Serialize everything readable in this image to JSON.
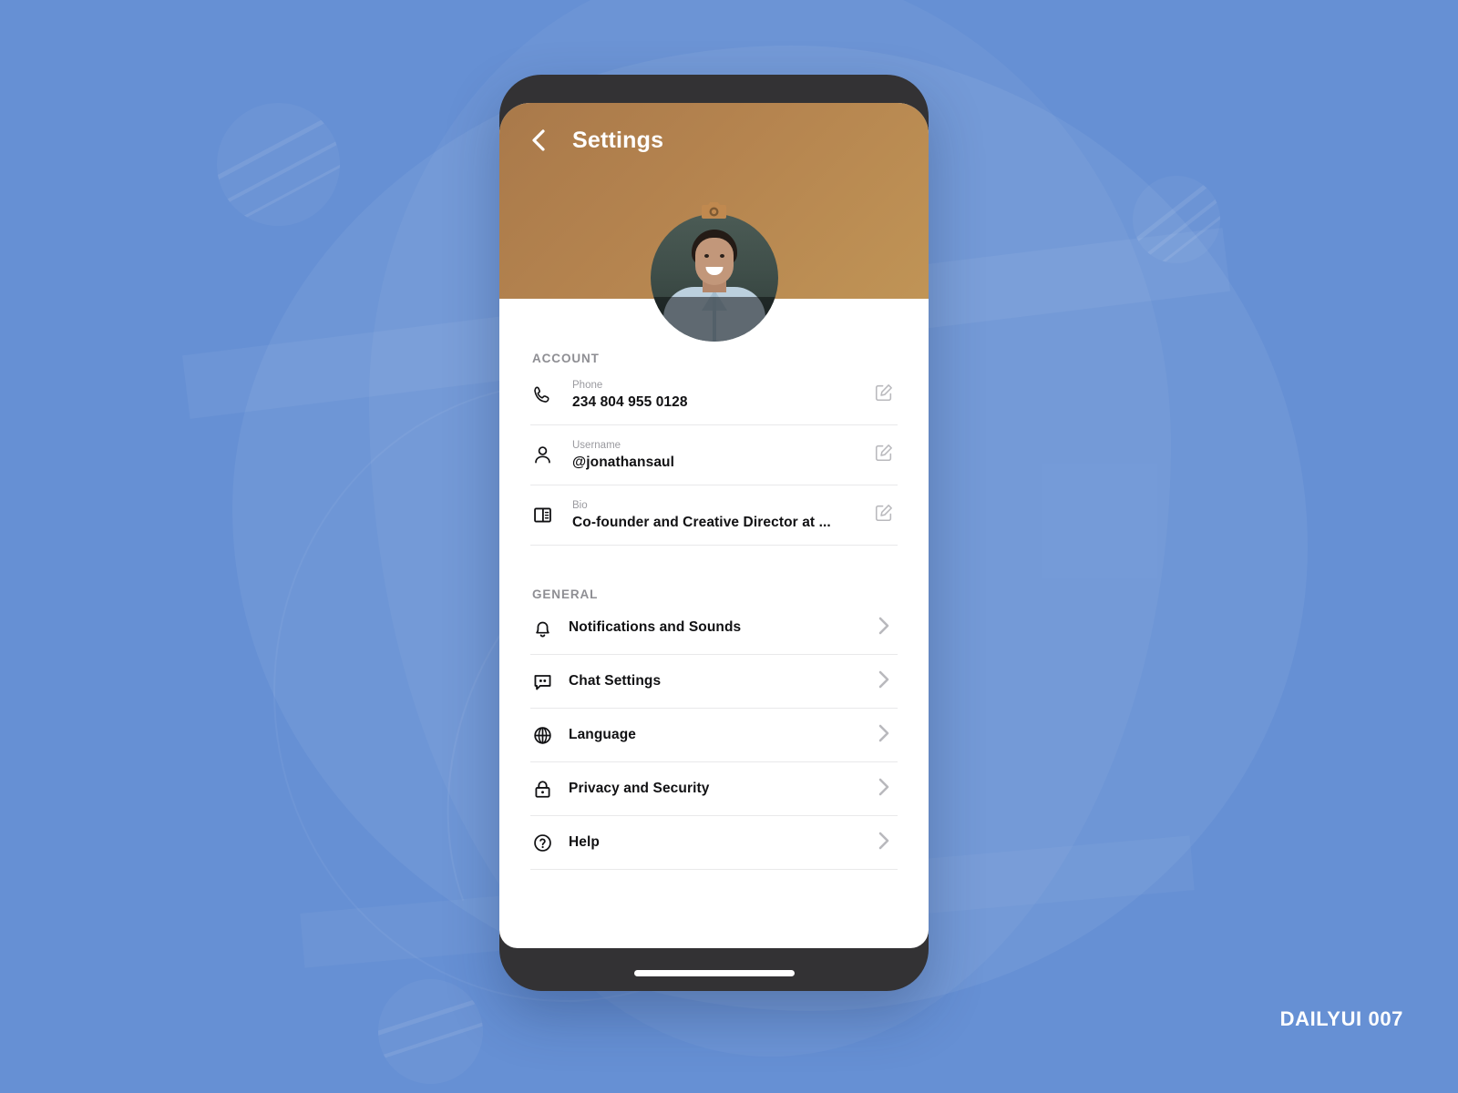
{
  "background": {
    "color": "#6690d4",
    "watermark": "DAILYUI 007"
  },
  "phone": {
    "bezel_color": "#333234",
    "home_indicator": "home-indicator"
  },
  "header": {
    "title": "Settings",
    "back_icon": "chevron-left-icon",
    "accent_color": "#b5844f",
    "gradient_from": "#a9794a",
    "gradient_to": "#c09456"
  },
  "avatar": {
    "name": "profile-photo",
    "camera_icon": "camera-icon",
    "overlay_color": "rgba(10,12,14,0.52)",
    "camera_tint": "#c0894f"
  },
  "account": {
    "section_label": "ACCOUNT",
    "items": [
      {
        "icon": "phone-icon",
        "label": "Phone",
        "value": "234 804 955 0128",
        "action_icon": "edit-icon"
      },
      {
        "icon": "user-icon",
        "label": "Username",
        "value": "@jonathansaul",
        "action_icon": "edit-icon"
      },
      {
        "icon": "bio-icon",
        "label": "Bio",
        "value": "Co-founder and Creative Director at ...",
        "action_icon": "edit-icon"
      }
    ]
  },
  "general": {
    "section_label": "GENERAL",
    "items": [
      {
        "icon": "bell-icon",
        "label": "Notifications and Sounds",
        "action_icon": "chevron-right-icon"
      },
      {
        "icon": "chat-icon",
        "label": "Chat Settings",
        "action_icon": "chevron-right-icon"
      },
      {
        "icon": "globe-icon",
        "label": "Language",
        "action_icon": "chevron-right-icon"
      },
      {
        "icon": "lock-icon",
        "label": "Privacy and Security",
        "action_icon": "chevron-right-icon"
      },
      {
        "icon": "help-icon",
        "label": "Help",
        "action_icon": "chevron-right-icon"
      }
    ]
  }
}
